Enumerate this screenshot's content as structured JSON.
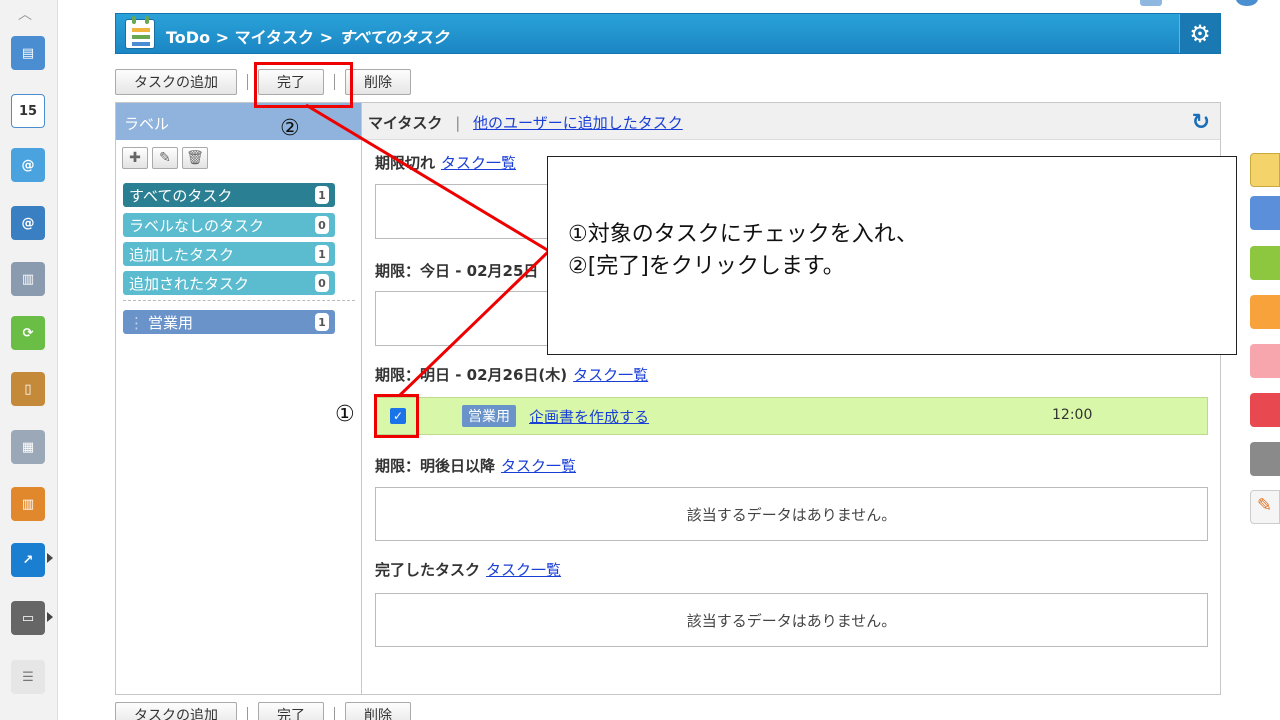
{
  "header": {
    "app": "ToDo",
    "sep": ">",
    "crumb": "マイタスク",
    "current": "すべてのタスク"
  },
  "toolbar": {
    "add": "タスクの追加",
    "done": "完了",
    "delete": "削除"
  },
  "labels": {
    "heading": "ラベル",
    "items": [
      {
        "name": "すべてのタスク",
        "count": "1",
        "color": "#2a7f93"
      },
      {
        "name": "ラベルなしのタスク",
        "count": "0",
        "color": "#5bbcd0"
      },
      {
        "name": "追加したタスク",
        "count": "1",
        "color": "#5bbcd0"
      },
      {
        "name": "追加されたタスク",
        "count": "0",
        "color": "#5bbcd0"
      },
      {
        "name": "営業用",
        "count": "1",
        "color": "#6a93c9"
      }
    ]
  },
  "tasks": {
    "my_tasks": "マイタスク",
    "divider": "|",
    "others_link": "他のユーザーに追加したタスク",
    "list_link": "タスク一覧",
    "overdue": "期限切れ",
    "today": "期限：今日 - 02月25日",
    "tomorrow": "期限：明日 - 02月26日(木)",
    "later": "期限：明後日以降",
    "completed": "完了したタスク",
    "empty": "該当するデータはありません。",
    "item": {
      "label": "営業用",
      "title": "企画書を作成する",
      "time": "12:00",
      "checked": true
    }
  },
  "annotation": {
    "line1": "①対象のタスクにチェックを入れ、",
    "line2": "②[完了]をクリックします。",
    "marker1": "①",
    "marker2": "②"
  }
}
